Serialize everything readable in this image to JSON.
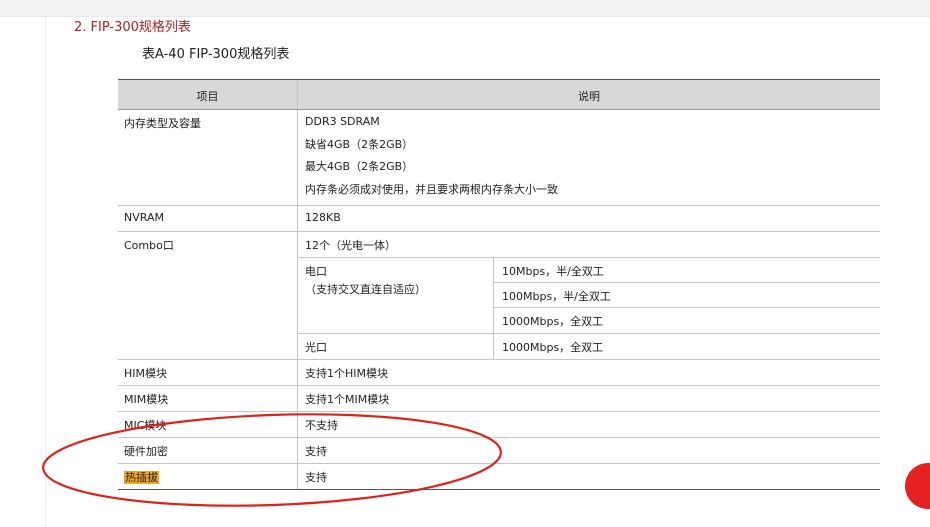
{
  "section": {
    "title": "2. FIP-300规格列表"
  },
  "caption": "表A-40 FIP-300规格列表",
  "table": {
    "headers": {
      "item": "项目",
      "desc": "说明"
    },
    "memory": {
      "label": "内存类型及容量",
      "lines": [
        "DDR3 SDRAM",
        "缺省4GB（2条2GB）",
        "最大4GB（2条2GB）",
        "内存条必须成对使用，并且要求两根内存条大小一致"
      ]
    },
    "nvram": {
      "label": "NVRAM",
      "value": "128KB"
    },
    "combo": {
      "label": "Combo口",
      "summary": "12个（光电一体）",
      "electrical": {
        "label": "电口",
        "note": "（支持交叉直连自适应）",
        "speeds": [
          "10Mbps，半/全双工",
          "100Mbps，半/全双工",
          "1000Mbps，全双工"
        ]
      },
      "optical": {
        "label": "光口",
        "speed": "1000Mbps，全双工"
      }
    },
    "him": {
      "label": "HIM模块",
      "value": "支持1个HIM模块"
    },
    "mim": {
      "label": "MIM模块",
      "value": "支持1个MIM模块"
    },
    "mic": {
      "label": "MIC模块",
      "value": "不支持"
    },
    "crypto": {
      "label": "硬件加密",
      "value": "支持"
    },
    "hotswap": {
      "label": "热插拔",
      "value": "支持"
    }
  },
  "colors": {
    "section_title": "#b31f1f",
    "header_bg": "#d8d8d8",
    "highlight": "#f5a623",
    "annotation_ellipse": "#e0201a",
    "badge": "#e52222"
  }
}
